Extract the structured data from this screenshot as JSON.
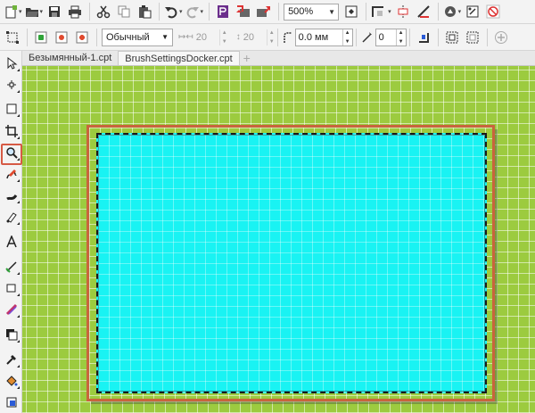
{
  "standard_toolbar": {
    "zoom_value": "500%",
    "icons": [
      "new-document-icon",
      "open-icon",
      "save-icon",
      "print-icon",
      "cut-icon",
      "copy-icon",
      "paste-icon",
      "undo-icon",
      "redo-icon",
      "publish-icon",
      "import-icon",
      "export-icon"
    ]
  },
  "property_bar": {
    "style_select": "Обычный",
    "width_value": "20",
    "height_value": "20",
    "outline_value": "0.0 мм",
    "angle_value": "0"
  },
  "tabs": [
    {
      "label": "Безымянный-1.cpt"
    },
    {
      "label": "BrushSettingsDocker.cpt"
    }
  ],
  "colors": {
    "canvas_green": "#9ccb3f",
    "shape_fill": "#19f3f3",
    "highlight": "#d65a45"
  }
}
